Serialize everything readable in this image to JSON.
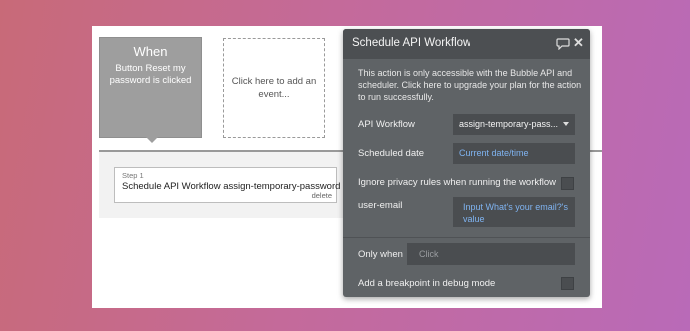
{
  "event": {
    "when_label": "When",
    "description": "Button Reset my password is clicked"
  },
  "add_event": {
    "label": "Click here to add an event..."
  },
  "step": {
    "number_label": "Step 1",
    "title": "Schedule API Workflow assign-temporary-password",
    "delete_label": "delete"
  },
  "panel": {
    "title": "Schedule API Workflow assign-temporary-password",
    "notice": "This action is only accessible with the Bubble API and scheduler. Click here to upgrade your plan for the action to run successfully.",
    "api_workflow_label": "API Workflow",
    "api_workflow_value": "assign-temporary-pass...",
    "scheduled_date_label": "Scheduled date",
    "scheduled_date_value": "Current date/time",
    "ignore_privacy_label": "Ignore privacy rules when running the workflow",
    "user_email_label": "user-email",
    "user_email_value": "Input What's your email?'s value",
    "only_when_label": "Only when",
    "only_when_placeholder": "Click",
    "breakpoint_label": "Add a breakpoint in debug mode",
    "ignore_privacy_checked": false,
    "breakpoint_checked": false
  },
  "colors": {
    "panel_bg": "#5f6366",
    "link": "#7fb3f0",
    "event_box": "#9e9e9e"
  }
}
